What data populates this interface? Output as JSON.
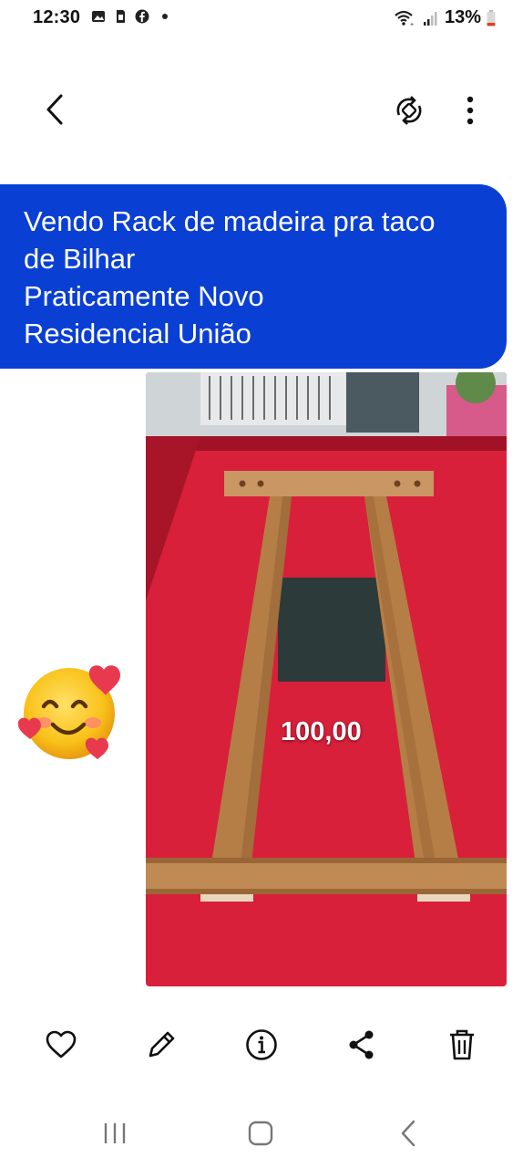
{
  "status_bar": {
    "time": "12:30",
    "battery": "13%"
  },
  "message": {
    "lines": [
      "Vendo Rack de madeira pra taco",
      "de Bilhar",
      "Praticamente Novo",
      "Residencial União"
    ],
    "bubble_color": "#0a3fd4"
  },
  "photo": {
    "price_label": "100,00"
  },
  "colors": {
    "felt": "#d8203a",
    "wood": "#b57e46",
    "accent": "#0a3fd4"
  },
  "icons": {
    "back": "back-arrow-icon",
    "rotate": "auto-rotate-icon",
    "more": "more-vertical-icon",
    "favorite": "heart-icon",
    "edit": "pencil-icon",
    "info": "info-icon",
    "share": "share-icon",
    "delete": "trash-icon",
    "emoji": "smiling-face-with-hearts-emoji"
  }
}
